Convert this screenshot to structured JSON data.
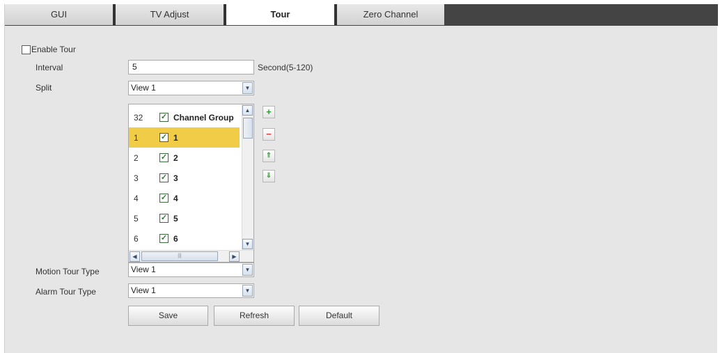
{
  "tabs": [
    {
      "label": "GUI",
      "active": false
    },
    {
      "label": "TV Adjust",
      "active": false
    },
    {
      "label": "Tour",
      "active": true
    },
    {
      "label": "Zero Channel",
      "active": false
    }
  ],
  "enable_tour": {
    "label": "Enable Tour",
    "checked": false
  },
  "interval": {
    "label": "Interval",
    "value": "5",
    "hint": "Second(5-120)"
  },
  "split": {
    "label": "Split",
    "value": "View 1"
  },
  "channel_list": {
    "header": {
      "num": "32",
      "name": "Channel Group",
      "checked": true
    },
    "rows": [
      {
        "num": "1",
        "name": "1",
        "checked": true,
        "selected": true
      },
      {
        "num": "2",
        "name": "2",
        "checked": true,
        "selected": false
      },
      {
        "num": "3",
        "name": "3",
        "checked": true,
        "selected": false
      },
      {
        "num": "4",
        "name": "4",
        "checked": true,
        "selected": false
      },
      {
        "num": "5",
        "name": "5",
        "checked": true,
        "selected": false
      },
      {
        "num": "6",
        "name": "6",
        "checked": true,
        "selected": false
      }
    ]
  },
  "motion_tour_type": {
    "label": "Motion Tour Type",
    "value": "View 1"
  },
  "alarm_tour_type": {
    "label": "Alarm Tour Type",
    "value": "View 1"
  },
  "buttons": {
    "save": "Save",
    "refresh": "Refresh",
    "default": "Default"
  },
  "colors": {
    "tabbar": "#444444",
    "selected_row": "#f1cc46",
    "add": "#2e9e2e",
    "remove": "#d23a3a"
  }
}
